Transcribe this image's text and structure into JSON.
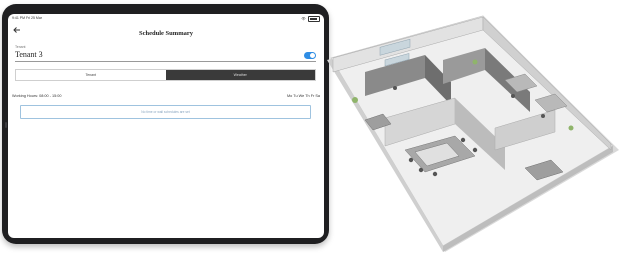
{
  "status_bar": {
    "time": "9:41 PM  Fri 25 Mar"
  },
  "app": {
    "title": "Schedule Summary"
  },
  "tenant": {
    "label": "Tenant",
    "value": "Tenant 3",
    "enabled": true
  },
  "tabs": [
    {
      "label": "Tenant",
      "active": false
    },
    {
      "label": "Weather",
      "active": true
    }
  ],
  "schedule": {
    "working_hours": "Working Hours: 08:00 - 15:00",
    "days": "Mo Tu We Th Fr Sa",
    "notice": "No time or wall schedules are set"
  },
  "colors": {
    "accent": "#2f8de4",
    "tablet_frame": "#1f1f21",
    "active_tab": "#3a3a3a",
    "notice_border": "#9fc3df"
  },
  "illustration": {
    "subject": "isometric-office-floor-plan"
  }
}
